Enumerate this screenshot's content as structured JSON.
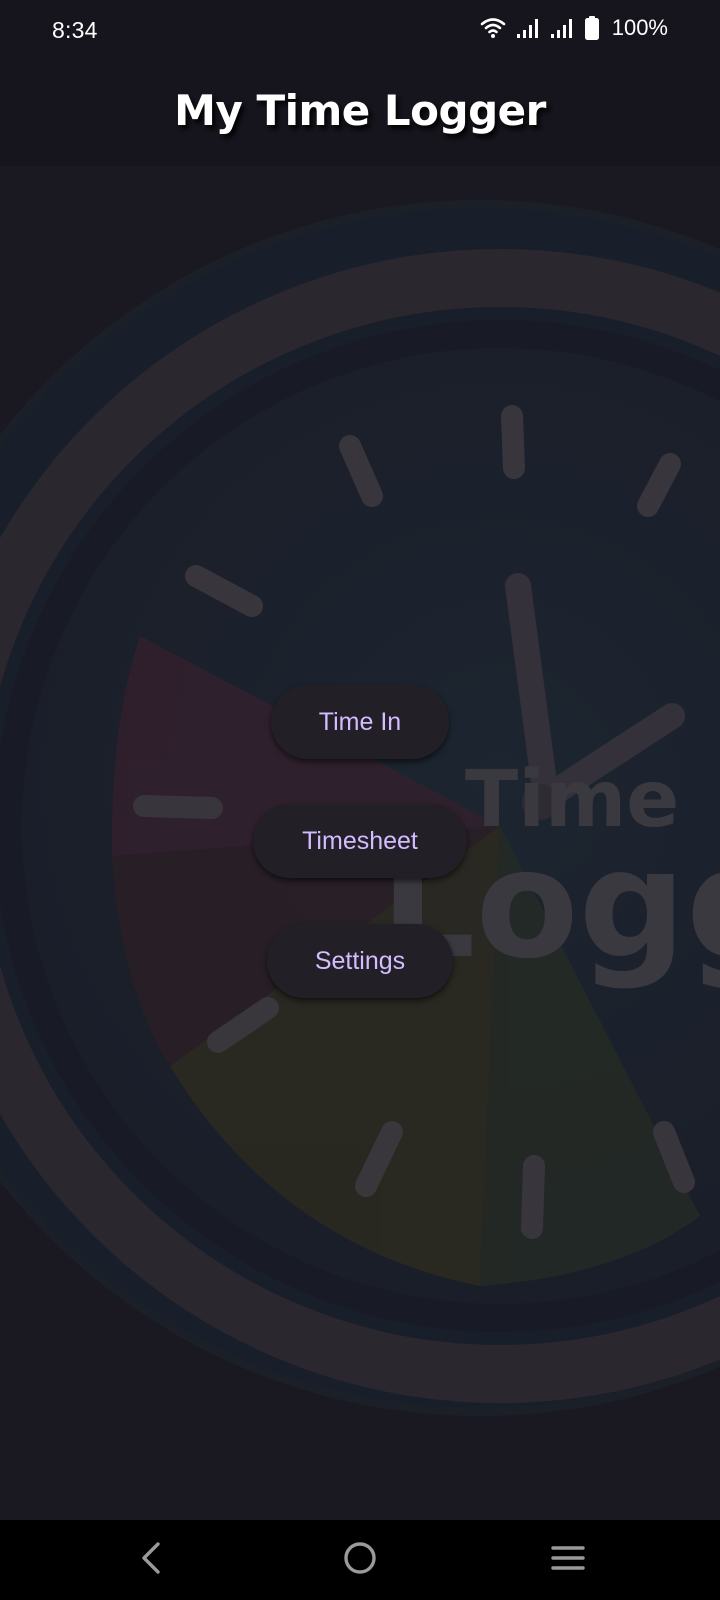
{
  "status_bar": {
    "time": "8:34",
    "battery_percent": "100%",
    "icons": [
      "wifi-icon",
      "signal-icon",
      "signal-icon",
      "battery-icon"
    ]
  },
  "app_bar": {
    "title": "My Time Logger"
  },
  "background": {
    "logo_text_line1": "Time",
    "logo_text_line2": "Logger",
    "colors": {
      "page": "#16141c",
      "clock_ring": "#2a272e",
      "clock_face": "#1c2330"
    }
  },
  "menu": {
    "time_in_label": "Time In",
    "timesheet_label": "Timesheet",
    "settings_label": "Settings"
  },
  "theme": {
    "button_text": "#d3bcff",
    "button_bg": "#221f27",
    "title_text": "#ffffff"
  },
  "nav_bar": {
    "icons": [
      "back-icon",
      "home-icon",
      "recents-icon"
    ]
  }
}
